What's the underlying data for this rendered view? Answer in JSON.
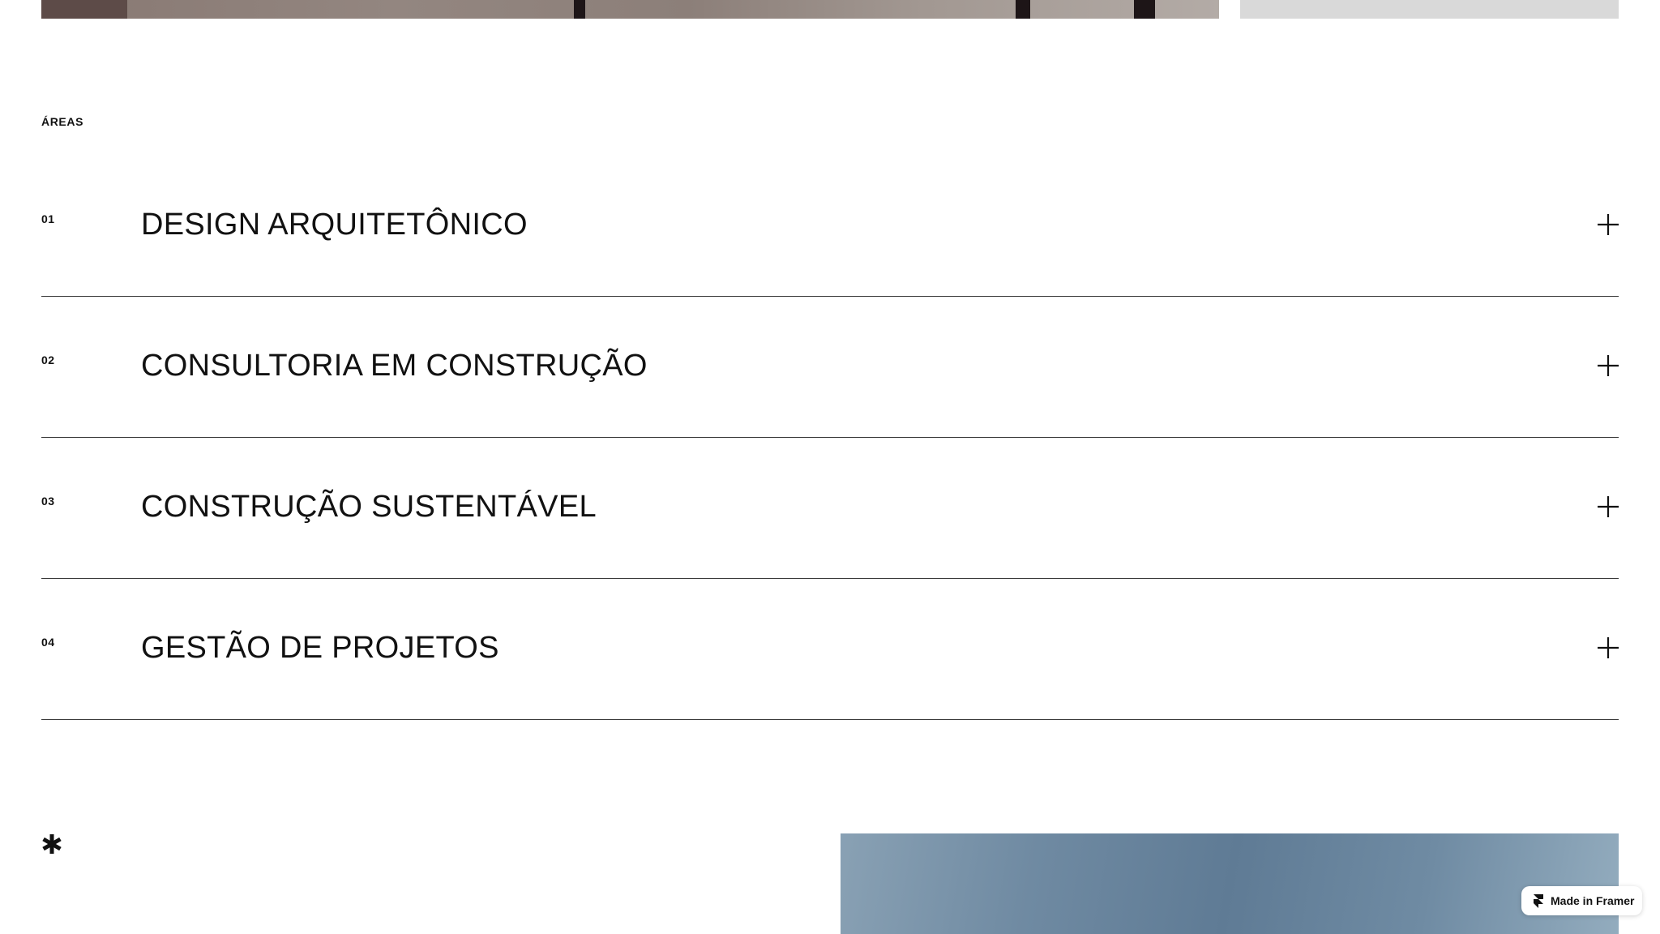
{
  "areas": {
    "label": "ÁREAS",
    "items": [
      {
        "number": "01",
        "title": "DESIGN ARQUITETÔNICO"
      },
      {
        "number": "02",
        "title": "CONSULTORIA EM CONSTRUÇÃO"
      },
      {
        "number": "03",
        "title": "CONSTRUÇÃO SUSTENTÁVEL"
      },
      {
        "number": "04",
        "title": "GESTÃO DE PROJETOS"
      }
    ]
  },
  "badge": {
    "label": "Made in Framer",
    "icon": "framer-logo-icon"
  },
  "icons": {
    "expand": "plus-icon",
    "decor": "asterisk-icon"
  },
  "colors": {
    "text": "#111111",
    "divider": "#3a3a3a",
    "placeholder": "#d9d9d9",
    "sky": "#6f8aa2"
  }
}
